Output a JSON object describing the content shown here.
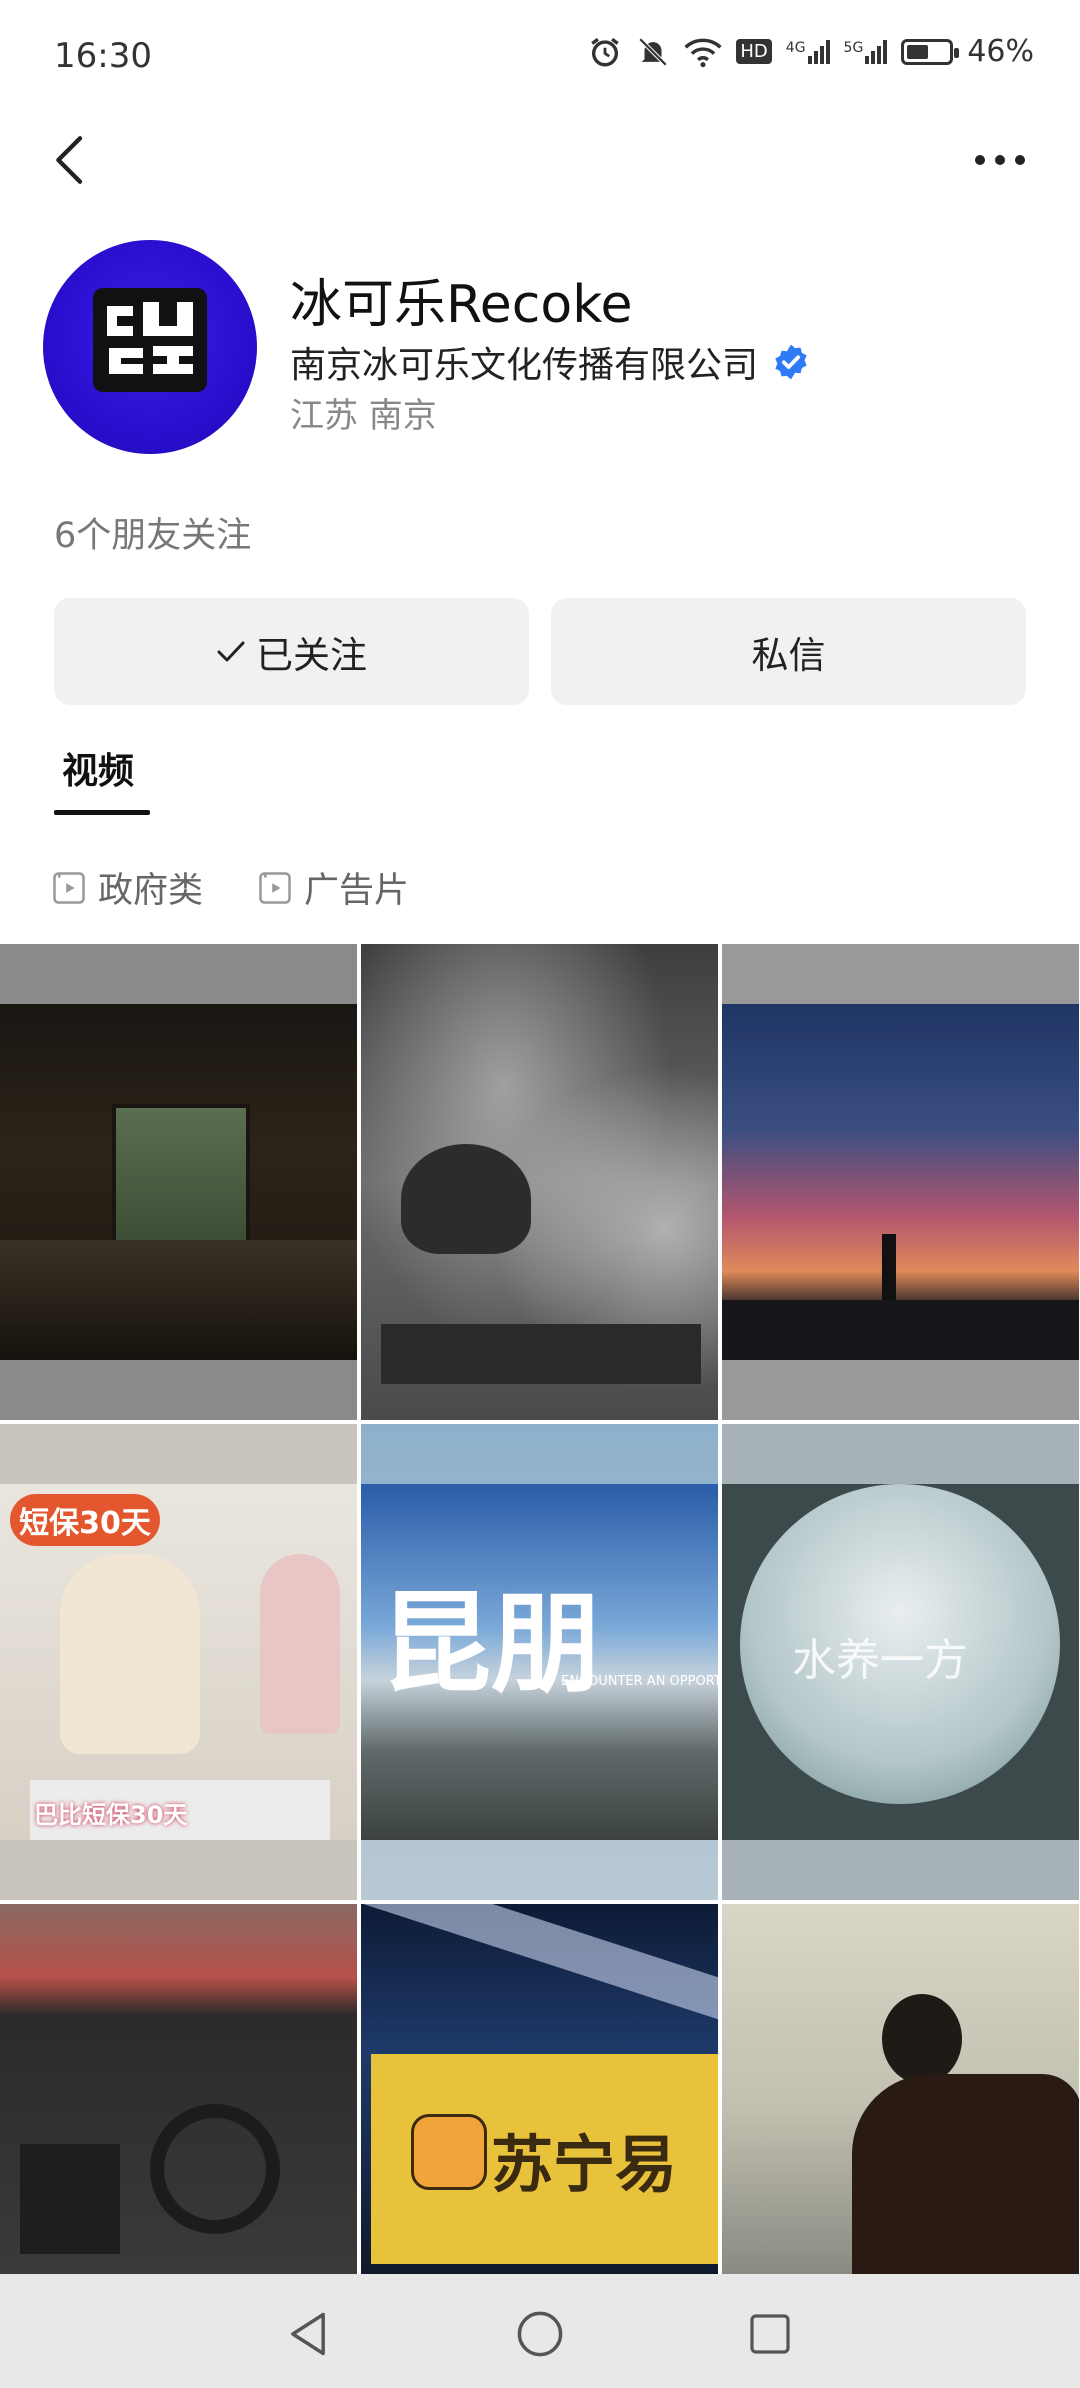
{
  "status_bar": {
    "time": "16:30",
    "network_hd": "HD",
    "signal_1": "4G",
    "signal_2": "5G",
    "battery_pct": "46%",
    "battery_level": 0.46,
    "icons": [
      "alarm-icon",
      "mute-icon",
      "wifi-icon",
      "hd-icon",
      "signal-4g-icon",
      "signal-5g-icon",
      "battery-charging-icon"
    ]
  },
  "header": {
    "back_icon": "chevron-left-icon",
    "more_icon": "more-dots-icon"
  },
  "profile": {
    "name": "冰可乐Recoke",
    "company": "南京冰可乐文化传播有限公司",
    "verified_icon": "verified-badge-icon",
    "location": "江苏 南京",
    "friends_follow": "6个朋友关注",
    "avatar_accent": "#2a0fd0"
  },
  "actions": {
    "follow_label": "已关注",
    "message_label": "私信"
  },
  "tabs": [
    {
      "label": "视频",
      "active": true
    }
  ],
  "playlists": [
    {
      "label": "政府类",
      "icon": "play-square-icon"
    },
    {
      "label": "广告片",
      "icon": "play-square-icon"
    }
  ],
  "videos": [
    {
      "id": 1,
      "overlay_text": ""
    },
    {
      "id": 2,
      "overlay_text": ""
    },
    {
      "id": 3,
      "overlay_text": ""
    },
    {
      "id": 4,
      "overlay_text": "短保30天",
      "overlay_text_2": "巴比短保30天"
    },
    {
      "id": 5,
      "overlay_text": "昆朋",
      "overlay_text_2": "ENCOUNTER AN OPPORTU"
    },
    {
      "id": 6,
      "overlay_text": "水养一方"
    },
    {
      "id": 7,
      "overlay_text": ""
    },
    {
      "id": 8,
      "overlay_text": "苏宁易"
    },
    {
      "id": 9,
      "overlay_text": ""
    }
  ],
  "nav_bar": {
    "icons": [
      "nav-back-icon",
      "nav-home-icon",
      "nav-recents-icon"
    ]
  }
}
